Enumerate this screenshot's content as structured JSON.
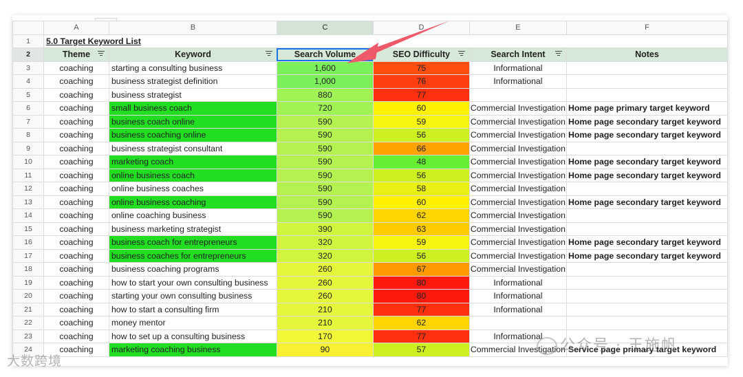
{
  "column_letters": [
    "A",
    "B",
    "C",
    "D",
    "E",
    "F"
  ],
  "title": "5.0 Target Keyword List",
  "headers": [
    "Theme",
    "Keyword",
    "Search Volume",
    "SEO Difficulty",
    "Search Intent",
    "Notes"
  ],
  "colors": {
    "keyword_highlight": "#22dd22",
    "volume": [
      "#7cf05a",
      "#a0f255",
      "#b4f250",
      "#cff53f",
      "#e6f63a",
      "#f2f738",
      "#f7f033"
    ],
    "difficulty": {
      "48": "#66ee33",
      "56": "#ccf022",
      "57": "#ccf022",
      "58": "#e8f014",
      "59": "#f7f411",
      "60": "#fff100",
      "62": "#ffd400",
      "63": "#ffcc00",
      "66": "#ffa200",
      "67": "#ff9a00",
      "75": "#ff4e10",
      "76": "#ff3f10",
      "77": "#ff3010",
      "80": "#ff1a10"
    }
  },
  "rows": [
    {
      "n": "3",
      "theme": "coaching",
      "keyword": "starting a consulting business",
      "volume": "1,600",
      "difficulty": "75",
      "intent": "Informational",
      "notes": "",
      "hl": false
    },
    {
      "n": "4",
      "theme": "coaching",
      "keyword": "business strategist definition",
      "volume": "1,000",
      "difficulty": "76",
      "intent": "Informational",
      "notes": "",
      "hl": false
    },
    {
      "n": "5",
      "theme": "coaching",
      "keyword": "business strategist",
      "volume": "880",
      "difficulty": "77",
      "intent": "",
      "notes": "",
      "hl": false
    },
    {
      "n": "6",
      "theme": "coaching",
      "keyword": "small business coach",
      "volume": "720",
      "difficulty": "60",
      "intent": "Commercial Investigation",
      "notes": "Home page primary target keyword",
      "hl": true
    },
    {
      "n": "7",
      "theme": "coaching",
      "keyword": "business coach online",
      "volume": "590",
      "difficulty": "59",
      "intent": "Commercial Investigation",
      "notes": "Home page secondary target keyword",
      "hl": true
    },
    {
      "n": "8",
      "theme": "coaching",
      "keyword": "business coaching online",
      "volume": "590",
      "difficulty": "56",
      "intent": "Commercial Investigation",
      "notes": "Home page secondary target keyword",
      "hl": true
    },
    {
      "n": "9",
      "theme": "coaching",
      "keyword": "business strategist consultant",
      "volume": "590",
      "difficulty": "66",
      "intent": "Commercial Investigation",
      "notes": "",
      "hl": false
    },
    {
      "n": "10",
      "theme": "coaching",
      "keyword": "marketing coach",
      "volume": "590",
      "difficulty": "48",
      "intent": "Commercial Investigation",
      "notes": "Home page secondary target keyword",
      "hl": true
    },
    {
      "n": "11",
      "theme": "coaching",
      "keyword": "online business coach",
      "volume": "590",
      "difficulty": "56",
      "intent": "Commercial Investigation",
      "notes": "Home page secondary target keyword",
      "hl": true
    },
    {
      "n": "12",
      "theme": "coaching",
      "keyword": "online business coaches",
      "volume": "590",
      "difficulty": "58",
      "intent": "Commercial Investigation",
      "notes": "",
      "hl": false
    },
    {
      "n": "13",
      "theme": "coaching",
      "keyword": "online business coaching",
      "volume": "590",
      "difficulty": "60",
      "intent": "Commercial Investigation",
      "notes": "Home page secondary target keyword",
      "hl": true
    },
    {
      "n": "14",
      "theme": "coaching",
      "keyword": "online coaching business",
      "volume": "590",
      "difficulty": "62",
      "intent": "Commercial Investigation",
      "notes": "",
      "hl": false
    },
    {
      "n": "15",
      "theme": "coaching",
      "keyword": "business marketing strategist",
      "volume": "390",
      "difficulty": "63",
      "intent": "Commercial Investigation",
      "notes": "",
      "hl": false
    },
    {
      "n": "16",
      "theme": "coaching",
      "keyword": "business coach for entrepreneurs",
      "volume": "320",
      "difficulty": "59",
      "intent": "Commercial Investigation",
      "notes": "Home page secondary target keyword",
      "hl": true
    },
    {
      "n": "17",
      "theme": "coaching",
      "keyword": "business coaches for entrepreneurs",
      "volume": "320",
      "difficulty": "56",
      "intent": "Commercial Investigation",
      "notes": "Home page secondary target keyword",
      "hl": true
    },
    {
      "n": "18",
      "theme": "coaching",
      "keyword": "business coaching programs",
      "volume": "260",
      "difficulty": "67",
      "intent": "Commercial Investigation",
      "notes": "",
      "hl": false
    },
    {
      "n": "19",
      "theme": "coaching",
      "keyword": "how to start your own consulting business",
      "volume": "260",
      "difficulty": "80",
      "intent": "Informational",
      "notes": "",
      "hl": false
    },
    {
      "n": "20",
      "theme": "coaching",
      "keyword": "starting your own consulting business",
      "volume": "260",
      "difficulty": "80",
      "intent": "Informational",
      "notes": "",
      "hl": false
    },
    {
      "n": "21",
      "theme": "coaching",
      "keyword": "how to start a consulting firm",
      "volume": "210",
      "difficulty": "77",
      "intent": "Informational",
      "notes": "",
      "hl": false
    },
    {
      "n": "22",
      "theme": "coaching",
      "keyword": "money mentor",
      "volume": "210",
      "difficulty": "62",
      "intent": "",
      "notes": "",
      "hl": false
    },
    {
      "n": "23",
      "theme": "coaching",
      "keyword": "how to set up a consulting business",
      "volume": "170",
      "difficulty": "77",
      "intent": "Informational",
      "notes": "",
      "hl": false
    },
    {
      "n": "24",
      "theme": "coaching",
      "keyword": "marketing coaching business",
      "volume": "90",
      "difficulty": "57",
      "intent": "Commercial Investigation",
      "notes": "Service page primary target keyword",
      "hl": true
    }
  ],
  "watermarks": {
    "wechat": "公众号 · 王施帆",
    "brand": "大数跨境"
  }
}
